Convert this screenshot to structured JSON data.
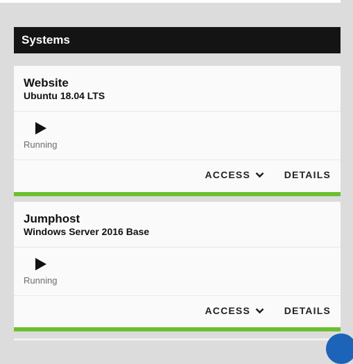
{
  "section": {
    "title": "Systems"
  },
  "systems": [
    {
      "name": "Website",
      "os": "Ubuntu 18.04 LTS",
      "status": "Running",
      "access_label": "ACCESS",
      "details_label": "DETAILS"
    },
    {
      "name": "Jumphost",
      "os": "Windows Server 2016 Base",
      "status": "Running",
      "access_label": "ACCESS",
      "details_label": "DETAILS"
    }
  ],
  "icons": {
    "play": "play-icon",
    "chevron": "chevron-down-icon"
  },
  "colors": {
    "header_bg": "#141414",
    "status_bar": "#6cbf2e",
    "fab": "#1d63b8"
  }
}
